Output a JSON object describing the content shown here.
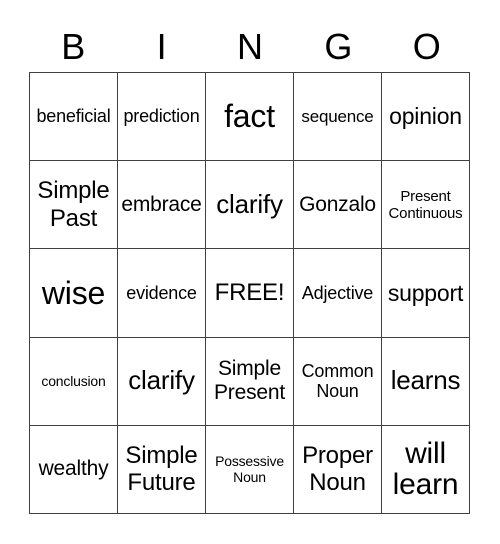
{
  "header": {
    "letters": [
      "B",
      "I",
      "N",
      "G",
      "O"
    ]
  },
  "board": {
    "rows": [
      [
        "beneficial",
        "prediction",
        "fact",
        "sequence",
        "opinion"
      ],
      [
        "Simple\nPast",
        "embrace",
        "clarify",
        "Gonzalo",
        "Present\nContinuous"
      ],
      [
        "wise",
        "evidence",
        "FREE!",
        "Adjective",
        "support"
      ],
      [
        "conclusion",
        "clarify",
        "Simple\nPresent",
        "Common\nNoun",
        "learns"
      ],
      [
        "wealthy",
        "Simple\nFuture",
        "Possessive\nNoun",
        "Proper\nNoun",
        "will\nlearn"
      ]
    ]
  },
  "colors": {
    "grid_line": "#404040",
    "text": "#000000",
    "background": "#ffffff"
  }
}
